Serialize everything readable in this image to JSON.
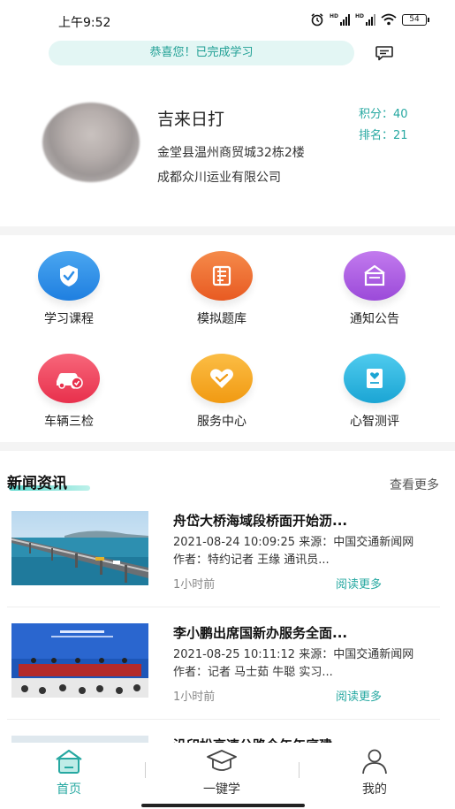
{
  "status_bar": {
    "time": "上午9:52",
    "battery": "54"
  },
  "notice": {
    "text": "恭喜您！已完成学习"
  },
  "profile": {
    "name": "吉来日打",
    "address": "金堂县温州商贸城32栋2楼",
    "company": "成都众川运业有限公司",
    "score": "积分：40",
    "rank": "排名：21"
  },
  "grid": [
    {
      "label": "学习课程",
      "icon": "shield-check-icon",
      "color": "#2f8fe8"
    },
    {
      "label": "模拟题库",
      "icon": "question-bank-icon",
      "color": "#f06a2e"
    },
    {
      "label": "通知公告",
      "icon": "notice-icon",
      "color": "#b05fe6"
    },
    {
      "label": "车辆三检",
      "icon": "car-check-icon",
      "color": "#f2475e"
    },
    {
      "label": "服务中心",
      "icon": "heart-icon",
      "color": "#f5a623"
    },
    {
      "label": "心智测评",
      "icon": "mental-test-icon",
      "color": "#28b5dd"
    }
  ],
  "news": {
    "header": "新闻资讯",
    "more": "查看更多",
    "items": [
      {
        "title": "舟岱大桥海域段桥面开始沥...",
        "meta": "2021-08-24 10:09:25 来源：中国交通新闻网 作者：特约记者 王缘 通讯员...",
        "time": "1小时前",
        "read_more": "阅读更多"
      },
      {
        "title": "李小鹏出席国新办服务全面...",
        "meta": "2021-08-25 10:11:12 来源：中国交通新闻网 作者：记者 马士茹 牛聪 实习...",
        "time": "1小时前",
        "read_more": "阅读更多"
      },
      {
        "title": "沿印松高速公路今年年底建...",
        "meta": "",
        "time": "",
        "read_more": ""
      }
    ]
  },
  "tabs": [
    {
      "label": "首页",
      "icon": "home-icon",
      "active": true
    },
    {
      "label": "一键学",
      "icon": "graduation-cap-icon",
      "active": false
    },
    {
      "label": "我的",
      "icon": "user-icon",
      "active": false
    }
  ],
  "colors": {
    "accent": "#26a8a1",
    "notice_bg": "#e3f6f4"
  }
}
